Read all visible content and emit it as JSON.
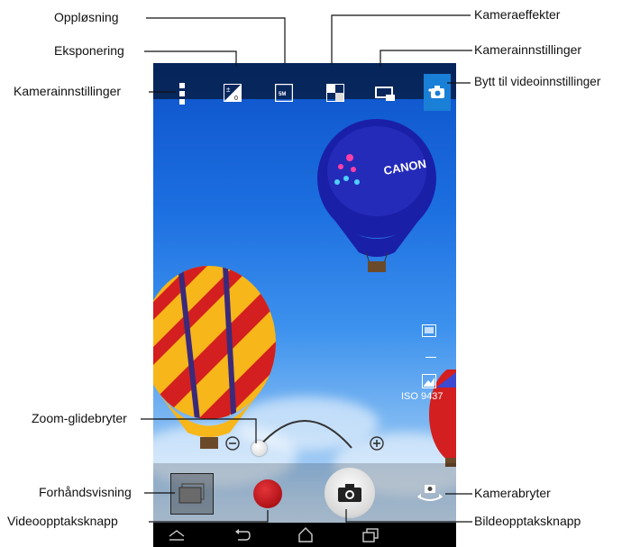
{
  "callouts": {
    "resolution": "Oppløsning",
    "exposure": "Eksponering",
    "camera_settings_left": "Kamerainnstillinger",
    "camera_effects": "Kameraeffekter",
    "camera_settings_right": "Kamerainnstillinger",
    "switch_video": "Bytt til videoinnstillinger",
    "zoom_slider": "Zoom-glidebryter",
    "preview": "Forhåndsvisning",
    "video_record": "Videoopptaksknapp",
    "camera_switch": "Kamerabryter",
    "photo_capture": "Bildeopptaksknapp"
  },
  "camera": {
    "resolution_badge": "5M",
    "iso_readout": "ISO 9437",
    "balloon_text": "CANON",
    "zoom_level": 0
  },
  "colors": {
    "accent_blue": "#1a7fd6",
    "record_red": "#c0141b"
  }
}
